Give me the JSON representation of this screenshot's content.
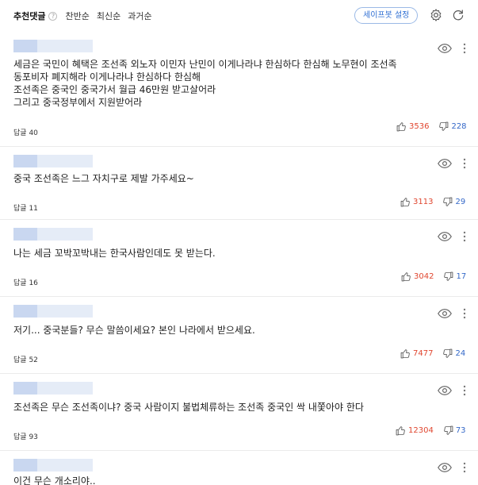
{
  "header": {
    "tabs": [
      {
        "label": "추천댓글",
        "active": true
      },
      {
        "label": "찬반순"
      },
      {
        "label": "최신순"
      },
      {
        "label": "과거순"
      }
    ],
    "help_label": "?",
    "safebot_label": "세이프봇 설정"
  },
  "comments": [
    {
      "text": "세금은 국민이 혜택은 조선족 외노자 이민자 난민이 이게나라냐 한심하다 한심해 노무현이 조선족\n동포비자 폐지해라 이게나라냐 한심하다 한심해\n조선족은 중국인 중국가서 월급 46만원 받고살어라\n그리고 중국정부에서 지원받어라",
      "reply_label": "답글",
      "reply_count": "40",
      "likes": "3536",
      "dislikes": "228"
    },
    {
      "text": "중국 조선족은 느그 자치구로 제발 가주세요~",
      "reply_label": "답글",
      "reply_count": "11",
      "likes": "3113",
      "dislikes": "29"
    },
    {
      "text": "나는 세금 꼬박꼬박내는 한국사람인데도 못 받는다.",
      "reply_label": "답글",
      "reply_count": "16",
      "likes": "3042",
      "dislikes": "17"
    },
    {
      "text": "저기... 중국분들? 무슨 말씀이세요? 본인 나라에서 받으세요.",
      "reply_label": "답글",
      "reply_count": "52",
      "likes": "7477",
      "dislikes": "24"
    },
    {
      "text": "조선족은 무슨 조선족이냐? 중국 사람이지 불법체류하는 조선족 중국인 싹 내쫓아야 한다",
      "reply_label": "답글",
      "reply_count": "93",
      "likes": "12304",
      "dislikes": "73"
    },
    {
      "text": "이건 무슨 개소리야..",
      "reply_label": "",
      "reply_count": "",
      "likes": "",
      "dislikes": ""
    }
  ],
  "colors": {
    "accent_blue": "#2f6fd3",
    "like_red": "#e0462f",
    "dislike_blue": "#3468c8"
  },
  "icons": [
    "help-icon",
    "gear-icon",
    "refresh-icon",
    "eye-icon",
    "more-vertical-icon",
    "thumbs-up-icon",
    "thumbs-down-icon"
  ]
}
